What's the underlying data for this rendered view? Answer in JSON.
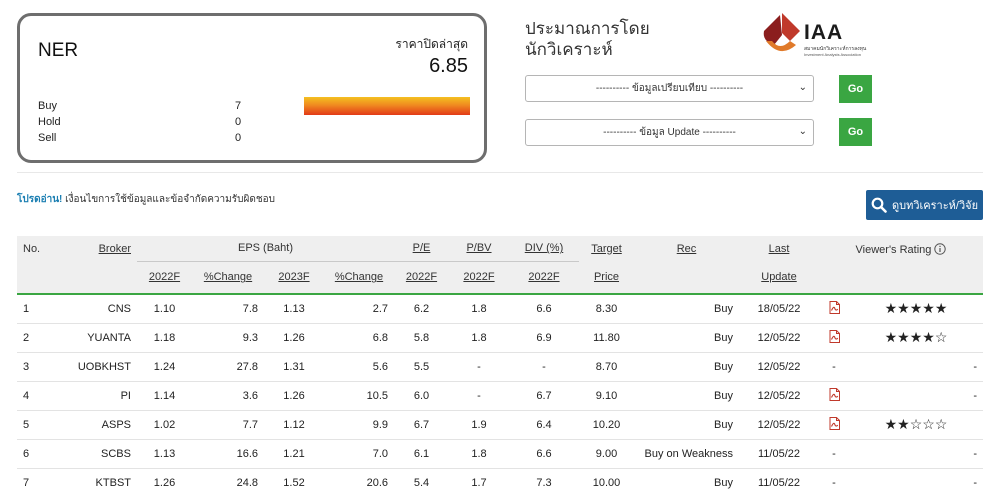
{
  "summary": {
    "ticker": "NER",
    "price_label": "ราคาปิดล่าสุด",
    "price": "6.85",
    "recs": [
      {
        "label": "Buy",
        "count": "7"
      },
      {
        "label": "Hold",
        "count": "0"
      },
      {
        "label": "Sell",
        "count": "0"
      }
    ],
    "buy_fraction": 1.0,
    "bar_colors": [
      "#f4c020",
      "#e23a18"
    ]
  },
  "estimate": {
    "title_line1": "ประมาณการโดย",
    "title_line2": "นักวิเคราะห์"
  },
  "logo": {
    "text": "IAA",
    "sub1": "สมาคมนักวิเคราะห์การลงทุน",
    "sub2": "Investment Analysts Association"
  },
  "selectors": [
    {
      "value": "---------- ข้อมูลเปรียบเทียบ ----------",
      "go_label": "Go"
    },
    {
      "value": "---------- ข้อมูล Update ----------",
      "go_label": "Go"
    }
  ],
  "notice": {
    "link": "โปรดอ่าน!",
    "text": " เงื่อนไขการใช้ข้อมูลและข้อจำกัดความรับผิดชอบ"
  },
  "analyst_button": {
    "label": "ดูบทวิเคราะห์/วิจัย",
    "icon": "search-icon"
  },
  "colors": {
    "accent_green": "#3aa642",
    "button_blue": "#1e5d96",
    "link_blue": "#1c7fb2",
    "star_green": "#2fa03c"
  },
  "table": {
    "headers": {
      "no": "No.",
      "broker": "Broker",
      "eps": "EPS (Baht)",
      "pe": "P/E",
      "pbv": "P/BV",
      "div": "DIV (%)",
      "target": "Target",
      "rec": "Rec",
      "last": "Last",
      "rating": "Viewer's Rating",
      "eps_2022": "2022F",
      "eps_chg1": "%Change",
      "eps_2023": "2023F",
      "eps_chg2": "%Change",
      "pe_2022": "2022F",
      "pbv_2022": "2022F",
      "div_2022": "2022F",
      "target_sub": "Price",
      "last_sub": "Update"
    },
    "rows": [
      {
        "no": "1",
        "broker": "CNS",
        "eps22": "1.10",
        "chg1": "7.8",
        "eps23": "1.13",
        "chg2": "2.7",
        "pe": "6.2",
        "pbv": "1.8",
        "div": "6.6",
        "target": "8.30",
        "rec": "Buy",
        "update": "18/05/22",
        "report": "pdf-icon",
        "rating": "★★★★★"
      },
      {
        "no": "2",
        "broker": "YUANTA",
        "eps22": "1.18",
        "chg1": "9.3",
        "eps23": "1.26",
        "chg2": "6.8",
        "pe": "5.8",
        "pbv": "1.8",
        "div": "6.9",
        "target": "11.80",
        "rec": "Buy",
        "update": "12/05/22",
        "report": "pdf-icon",
        "rating": "★★★★☆"
      },
      {
        "no": "3",
        "broker": "UOBKHST",
        "eps22": "1.24",
        "chg1": "27.8",
        "eps23": "1.31",
        "chg2": "5.6",
        "pe": "5.5",
        "pbv": "-",
        "div": "-",
        "target": "8.70",
        "rec": "Buy",
        "update": "12/05/22",
        "report": "-",
        "rating": "-"
      },
      {
        "no": "4",
        "broker": "PI",
        "eps22": "1.14",
        "chg1": "3.6",
        "eps23": "1.26",
        "chg2": "10.5",
        "pe": "6.0",
        "pbv": "-",
        "div": "6.7",
        "target": "9.10",
        "rec": "Buy",
        "update": "12/05/22",
        "report": "pdf-icon",
        "rating": "-"
      },
      {
        "no": "5",
        "broker": "ASPS",
        "eps22": "1.02",
        "chg1": "7.7",
        "eps23": "1.12",
        "chg2": "9.9",
        "pe": "6.7",
        "pbv": "1.9",
        "div": "6.4",
        "target": "10.20",
        "rec": "Buy",
        "update": "12/05/22",
        "report": "pdf-icon",
        "rating": "★★☆☆☆"
      },
      {
        "no": "6",
        "broker": "SCBS",
        "eps22": "1.13",
        "chg1": "16.6",
        "eps23": "1.21",
        "chg2": "7.0",
        "pe": "6.1",
        "pbv": "1.8",
        "div": "6.6",
        "target": "9.00",
        "rec": "Buy on Weakness",
        "update": "11/05/22",
        "report": "-",
        "rating": "-"
      },
      {
        "no": "7",
        "broker": "KTBST",
        "eps22": "1.26",
        "chg1": "24.8",
        "eps23": "1.52",
        "chg2": "20.6",
        "pe": "5.4",
        "pbv": "1.7",
        "div": "7.3",
        "target": "10.00",
        "rec": "Buy",
        "update": "11/05/22",
        "report": "-",
        "rating": "-"
      }
    ]
  }
}
